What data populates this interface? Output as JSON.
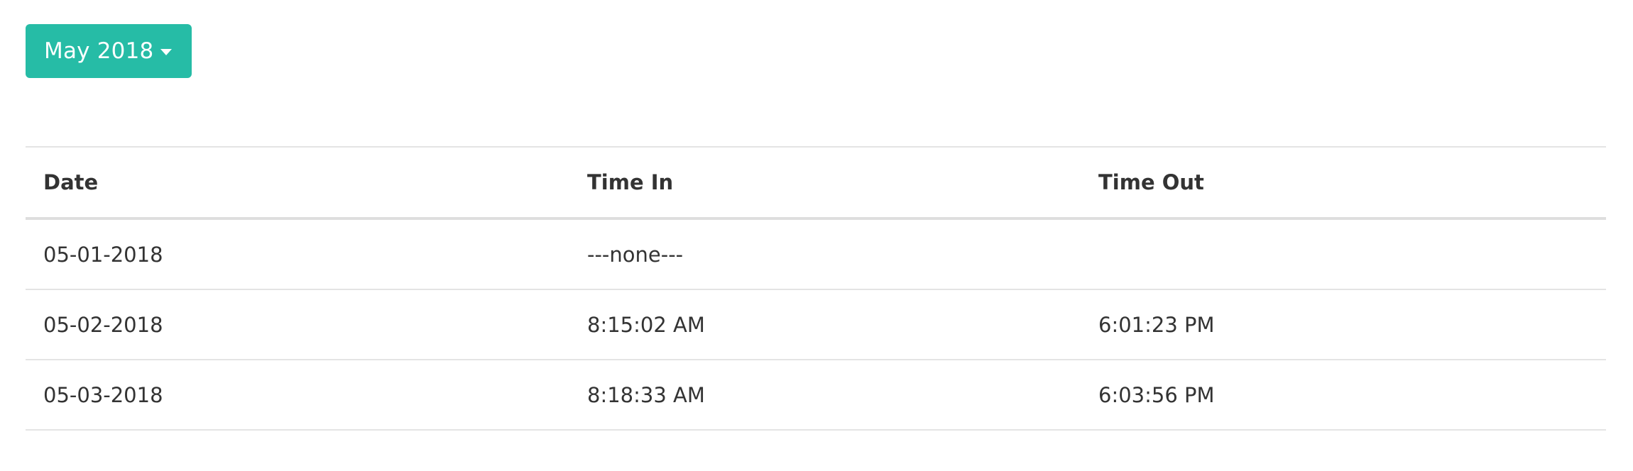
{
  "month_selector": {
    "label": "May 2018"
  },
  "table": {
    "headers": {
      "date": "Date",
      "time_in": "Time In",
      "time_out": "Time Out"
    },
    "rows": [
      {
        "date": "05-01-2018",
        "time_in": "---none---",
        "time_out": ""
      },
      {
        "date": "05-02-2018",
        "time_in": "8:15:02 AM",
        "time_out": "6:01:23 PM"
      },
      {
        "date": "05-03-2018",
        "time_in": "8:18:33 AM",
        "time_out": "6:03:56 PM"
      }
    ]
  },
  "colors": {
    "accent": "#26bca6",
    "text": "#333333",
    "border": "#e4e4e4"
  }
}
